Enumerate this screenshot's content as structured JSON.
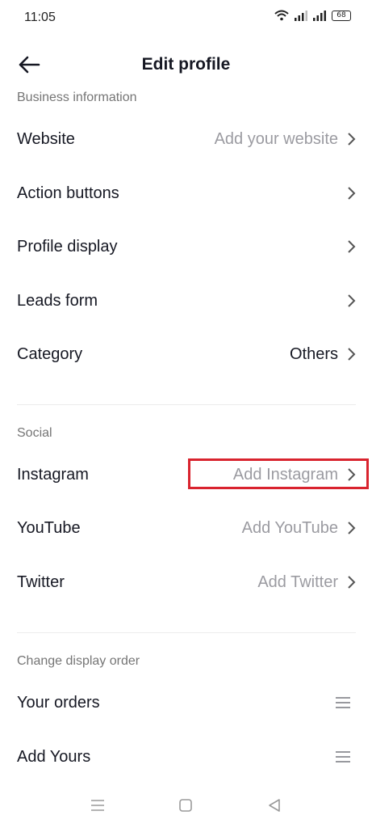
{
  "status_bar": {
    "time": "11:05",
    "battery": "68",
    "icons": [
      "wifi-icon",
      "signal-icon",
      "signal-icon",
      "battery-icon"
    ]
  },
  "header": {
    "title": "Edit profile",
    "back_icon": "arrow-left-icon"
  },
  "business": {
    "section_label": "Business information",
    "items": [
      {
        "label": "Website",
        "value": "Add your website",
        "value_style": "placeholder"
      },
      {
        "label": "Action buttons",
        "value": "",
        "value_style": "placeholder"
      },
      {
        "label": "Profile display",
        "value": "",
        "value_style": "placeholder"
      },
      {
        "label": "Leads form",
        "value": "",
        "value_style": "placeholder"
      },
      {
        "label": "Category",
        "value": "Others",
        "value_style": "set"
      }
    ]
  },
  "social": {
    "section_label": "Social",
    "items": [
      {
        "label": "Instagram",
        "value": "Add Instagram"
      },
      {
        "label": "YouTube",
        "value": "Add YouTube"
      },
      {
        "label": "Twitter",
        "value": "Add Twitter"
      }
    ],
    "highlight_color": "#d9232e"
  },
  "display_order": {
    "section_label": "Change display order",
    "items": [
      {
        "label": "Your orders"
      },
      {
        "label": "Add Yours"
      }
    ]
  },
  "nav_bar": {
    "buttons": [
      "menu-icon",
      "home-square-icon",
      "back-triangle-icon"
    ]
  },
  "colors": {
    "text_primary": "#161823",
    "text_placeholder": "#9b9ba1",
    "section_label": "#757575",
    "highlight": "#d9232e"
  }
}
